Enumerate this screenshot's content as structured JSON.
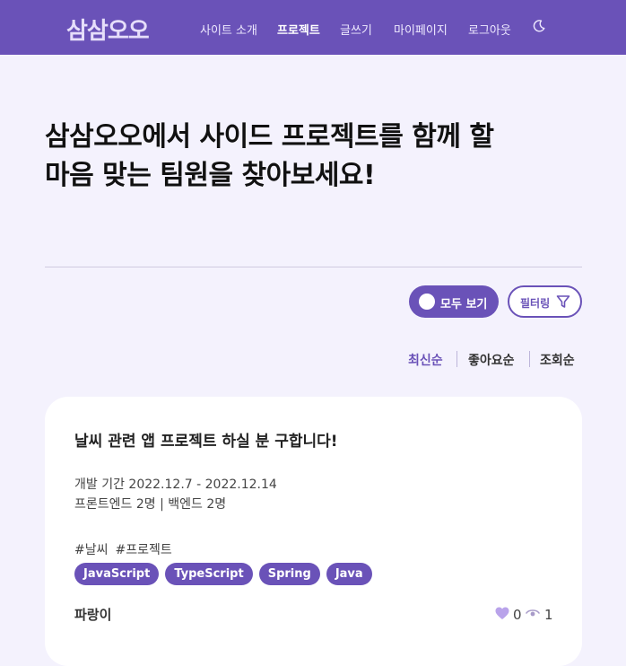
{
  "nav": {
    "logo": "삼삼오오",
    "items": [
      "사이트 소개",
      "프로젝트",
      "글쓰기",
      "마이페이지",
      "로그아웃"
    ],
    "active_index": 1,
    "theme_icon": "moon-icon"
  },
  "hero": {
    "line1": "삼삼오오에서 사이드 프로젝트를 함께 할",
    "line2": "마음 맞는 팀원을 찾아보세요!"
  },
  "controls": {
    "toggle_label": "모두 보기",
    "filter_label": "필터링",
    "filter_icon": "filter-icon"
  },
  "sort": {
    "options": [
      "최신순",
      "좋아요순",
      "조회순"
    ],
    "active_index": 0
  },
  "card": {
    "title": "날씨 관련 앱 프로젝트 하실 분 구합니다!",
    "period": "개발 기간 2022.12.7 - 2022.12.14",
    "recruit": "프론트엔드 2명 | 백엔드 2명",
    "hashtags": [
      "#날씨",
      "#프로젝트"
    ],
    "tech": [
      "JavaScript",
      "TypeScript",
      "Spring",
      "Java"
    ],
    "author": "파랑이",
    "likes": "0",
    "views": "1"
  },
  "colors": {
    "primary": "#6a52b8",
    "background": "#f4f2fd",
    "heart": "#b9a3ea"
  }
}
